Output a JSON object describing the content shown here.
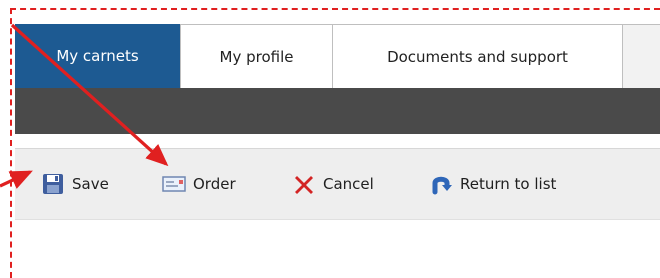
{
  "tabs": [
    {
      "label": "My carnets",
      "active": true
    },
    {
      "label": "My profile",
      "active": false
    },
    {
      "label": "Documents and support",
      "active": false
    }
  ],
  "toolbar": {
    "save_label": "Save",
    "order_label": "Order",
    "cancel_label": "Cancel",
    "return_label": "Return to list"
  },
  "icons": {
    "save": "floppy-disk-icon",
    "order": "envelope-card-icon",
    "cancel": "red-x-icon",
    "return": "return-arrow-icon"
  },
  "colors": {
    "accent": "#1d5a92",
    "darkbar": "#4a4a4a",
    "annotation": "#e02020"
  }
}
